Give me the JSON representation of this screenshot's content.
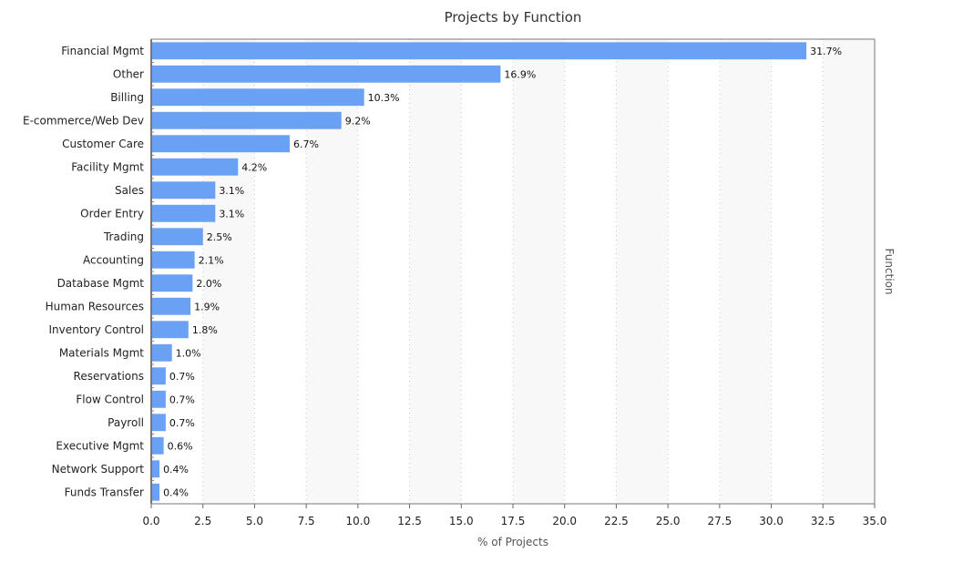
{
  "chart_data": {
    "type": "bar",
    "orientation": "horizontal",
    "title": "Projects by Function",
    "xlabel": "% of Projects",
    "ylabel": "Function",
    "xlim": [
      0,
      35
    ],
    "xticks": [
      "0.0",
      "2.5",
      "5.0",
      "7.5",
      "10.0",
      "12.5",
      "15.0",
      "17.5",
      "20.0",
      "22.5",
      "25.0",
      "27.5",
      "30.0",
      "32.5",
      "35.0"
    ],
    "grid": true,
    "categories": [
      "Financial Mgmt",
      "Other",
      "Billing",
      "E-commerce/Web Dev",
      "Customer Care",
      "Facility Mgmt",
      "Sales",
      "Order Entry",
      "Trading",
      "Accounting",
      "Database Mgmt",
      "Human Resources",
      "Inventory Control",
      "Materials Mgmt",
      "Reservations",
      "Flow Control",
      "Payroll",
      "Executive Mgmt",
      "Network Support",
      "Funds Transfer"
    ],
    "values": [
      31.7,
      16.9,
      10.3,
      9.2,
      6.7,
      4.2,
      3.1,
      3.1,
      2.5,
      2.1,
      2.0,
      1.9,
      1.8,
      1.0,
      0.7,
      0.7,
      0.7,
      0.6,
      0.4,
      0.4
    ],
    "data_labels": [
      "31.7%",
      "16.9%",
      "10.3%",
      "9.2%",
      "6.7%",
      "4.2%",
      "3.1%",
      "3.1%",
      "2.5%",
      "2.1%",
      "2.0%",
      "1.9%",
      "1.8%",
      "1.0%",
      "0.7%",
      "0.7%",
      "0.7%",
      "0.6%",
      "0.4%",
      "0.4%"
    ],
    "bar_color": "#6aa1f5",
    "band_color": "#f8f8f8"
  }
}
